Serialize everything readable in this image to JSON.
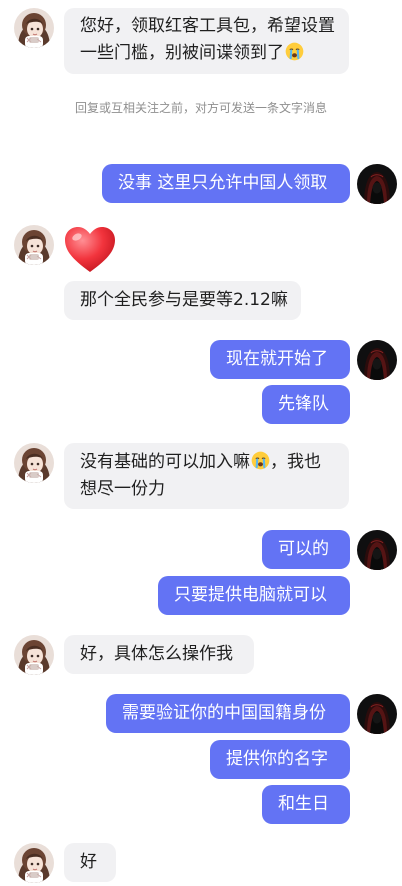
{
  "system_note": "回复或互相关注之前，对方可发送一条文字消息",
  "messages": [
    {
      "side": "in",
      "text": "您好，领取红客工具包，希望设置一些门槛，别被间谍领到了",
      "emoji": "crying-face"
    },
    {
      "side": "out",
      "text": "没事 这里只允许中国人领取"
    },
    {
      "side": "in",
      "emoji": "heart"
    },
    {
      "side": "in",
      "text": "那个全民参与是要等2.12嘛"
    },
    {
      "side": "out",
      "text": "现在就开始了"
    },
    {
      "side": "out",
      "text": "先锋队"
    },
    {
      "side": "in",
      "text_before": "没有基础的可以加入嘛",
      "emoji": "crying-face",
      "text_after": "，我也想尽一份力"
    },
    {
      "side": "out",
      "text": "可以的"
    },
    {
      "side": "out",
      "text": "只要提供电脑就可以"
    },
    {
      "side": "in",
      "text": "好，具体怎么操作我"
    },
    {
      "side": "out",
      "text": "需要验证你的中国国籍身份"
    },
    {
      "side": "out",
      "text": "提供你的名字"
    },
    {
      "side": "out",
      "text": "和生日"
    },
    {
      "side": "in",
      "text": "好"
    }
  ],
  "colors": {
    "outgoing_bubble": "#6373f4",
    "incoming_bubble": "#f1f1f3",
    "system_text": "#8f8f8f"
  },
  "icons": {
    "incoming_avatar": "anime-girl-avatar-icon",
    "outgoing_avatar": "hooded-figure-avatar-icon",
    "emoji_crying": "crying-face-icon",
    "emoji_heart": "heart-icon"
  }
}
